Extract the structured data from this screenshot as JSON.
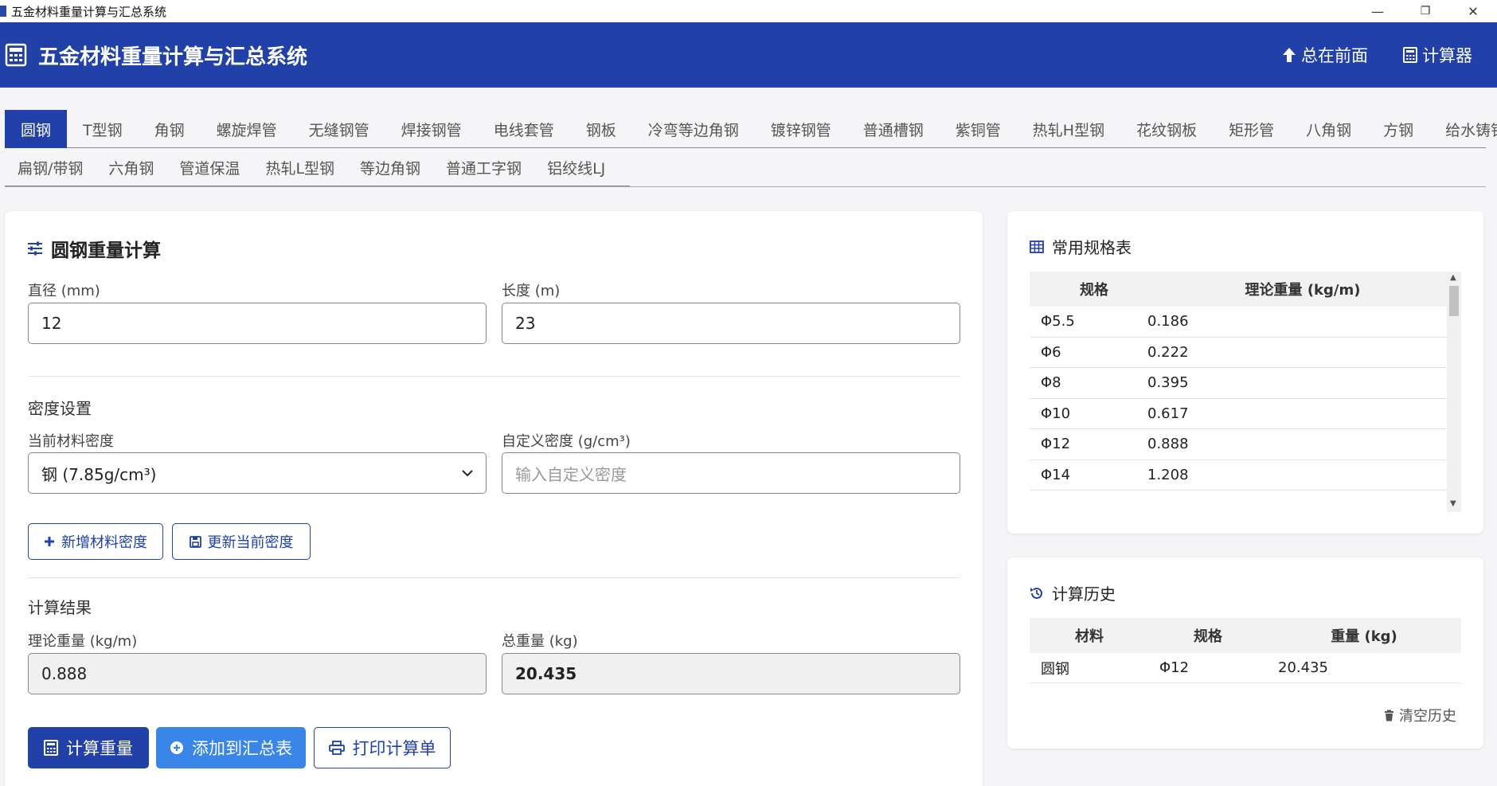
{
  "window": {
    "title": "五金材料重量计算与汇总系统",
    "minimize": "—",
    "maximize": "❐",
    "close": "✕"
  },
  "header": {
    "title": "五金材料重量计算与汇总系统",
    "always_on_top": "总在前面",
    "calculator": "计算器"
  },
  "tabs_row1": [
    "圆钢",
    "T型钢",
    "角钢",
    "螺旋焊管",
    "无缝钢管",
    "焊接钢管",
    "电线套管",
    "钢板",
    "冷弯等边角钢",
    "镀锌钢管",
    "普通槽钢",
    "紫铜管",
    "热轧H型钢",
    "花纹钢板",
    "矩形管",
    "八角钢",
    "方钢",
    "给水铸铁管"
  ],
  "tabs_row2": [
    "扁钢/带钢",
    "六角钢",
    "管道保温",
    "热轧L型钢",
    "等边角钢",
    "普通工字钢",
    "铝绞线LJ"
  ],
  "calc": {
    "title": "圆钢重量计算",
    "diameter_label": "直径 (mm)",
    "diameter_value": "12",
    "length_label": "长度 (m)",
    "length_value": "23",
    "density_section": "密度设置",
    "current_density_label": "当前材料密度",
    "current_density_value": "钢 (7.85g/cm³)",
    "custom_density_label": "自定义密度 (g/cm³)",
    "custom_density_placeholder": "输入自定义密度",
    "add_density": "新增材料密度",
    "update_density": "更新当前密度",
    "result_section": "计算结果",
    "theory_label": "理论重量 (kg/m)",
    "theory_value": "0.888",
    "total_label": "总重量 (kg)",
    "total_value": "20.435",
    "calc_button": "计算重量",
    "add_summary_button": "添加到汇总表",
    "print_button": "打印计算单"
  },
  "spec": {
    "title": "常用规格表",
    "col_spec": "规格",
    "col_weight": "理论重量 (kg/m)",
    "rows": [
      {
        "spec": "Φ5.5",
        "weight": "0.186"
      },
      {
        "spec": "Φ6",
        "weight": "0.222"
      },
      {
        "spec": "Φ8",
        "weight": "0.395"
      },
      {
        "spec": "Φ10",
        "weight": "0.617"
      },
      {
        "spec": "Φ12",
        "weight": "0.888"
      },
      {
        "spec": "Φ14",
        "weight": "1.208"
      }
    ]
  },
  "history": {
    "title": "计算历史",
    "col_material": "材料",
    "col_spec": "规格",
    "col_weight": "重量 (kg)",
    "rows": [
      {
        "material": "圆钢",
        "spec": "Φ12",
        "weight": "20.435"
      }
    ],
    "clear": "清空历史"
  },
  "colors": {
    "primary": "#2140a8",
    "info": "#3a86e8"
  }
}
